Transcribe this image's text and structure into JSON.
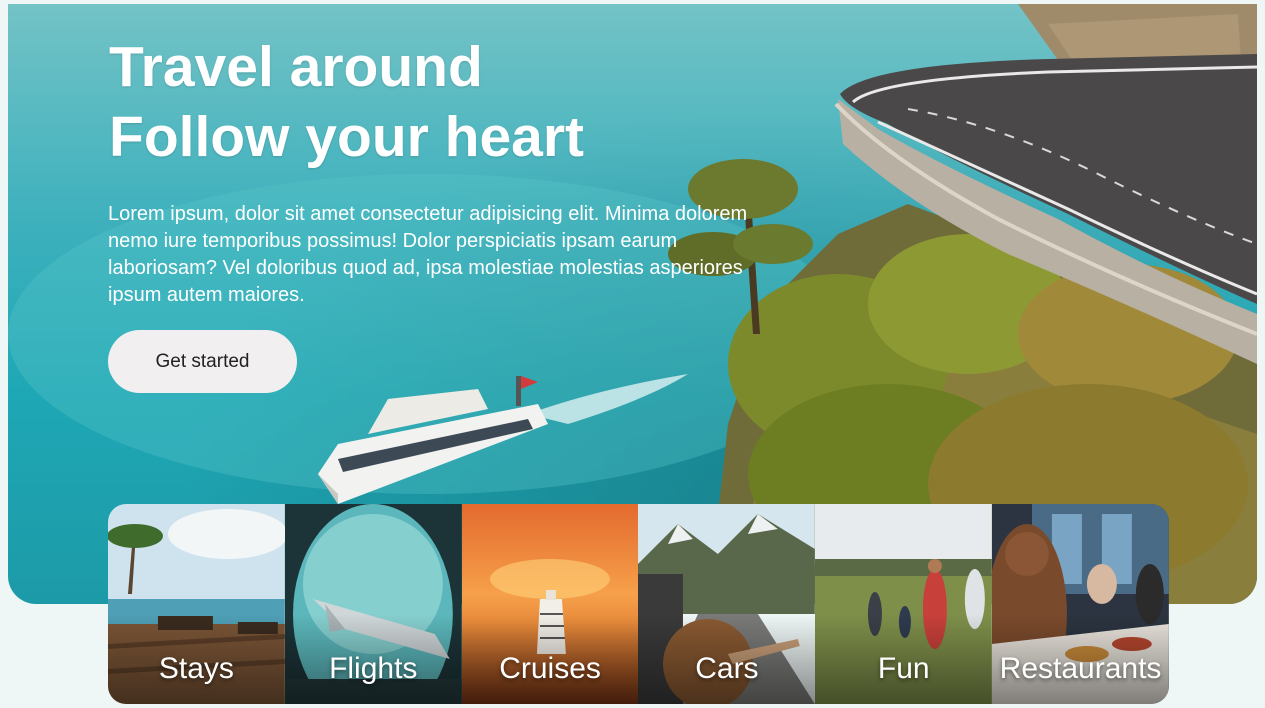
{
  "hero": {
    "title_line_1": "Travel around",
    "title_line_2": "Follow your heart",
    "description": "Lorem ipsum, dolor sit amet consectetur adipisicing elit. Minima dolorem nemo iure temporibus possimus! Dolor perspiciatis ipsam earum laboriosam? Vel doloribus quod ad, ipsa molestiae molestias asperiores ipsum autem maiores.",
    "cta_label": "Get started"
  },
  "categories": [
    {
      "label": "Stays"
    },
    {
      "label": "Flights"
    },
    {
      "label": "Cruises"
    },
    {
      "label": "Cars"
    },
    {
      "label": "Fun"
    },
    {
      "label": "Restaurants"
    }
  ]
}
